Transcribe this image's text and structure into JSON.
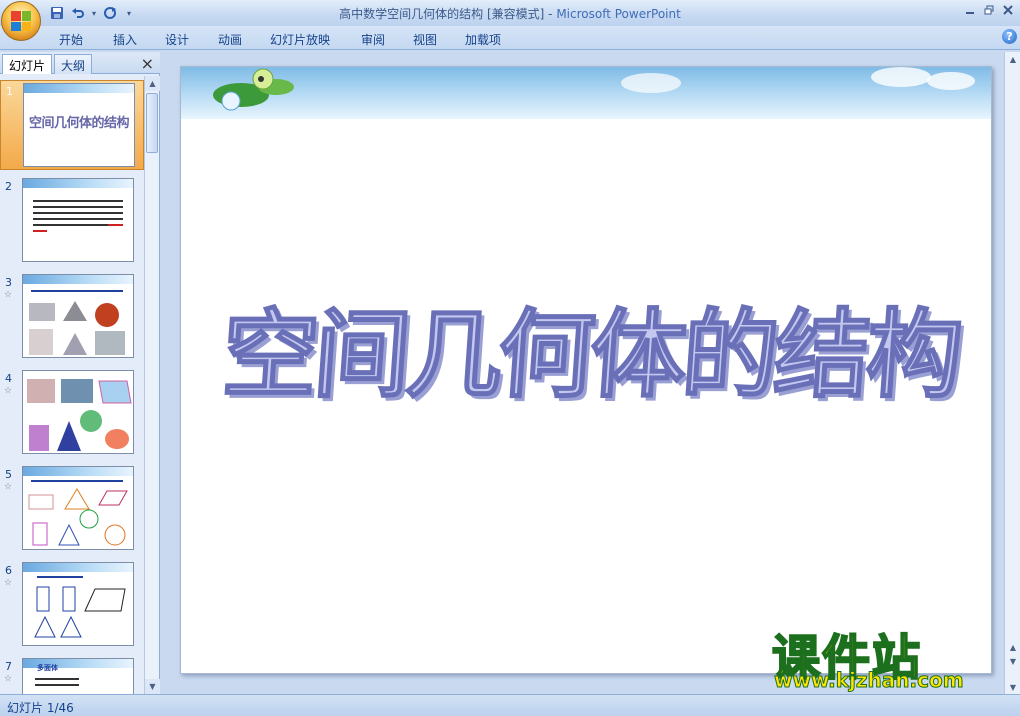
{
  "window": {
    "title": "高中数学空间几何体的结构 [兼容模式]",
    "app_name": "Microsoft PowerPoint",
    "separator": " - "
  },
  "qat": {
    "save": "save-icon",
    "undo": "undo-icon",
    "redo": "redo-icon",
    "customize": "▾"
  },
  "ribbon": {
    "tabs": [
      "开始",
      "插入",
      "设计",
      "动画",
      "幻灯片放映",
      "审阅",
      "视图",
      "加载项"
    ],
    "help": "?"
  },
  "panel": {
    "tab_slides": "幻灯片",
    "tab_outline": "大纲",
    "close": "×",
    "thumbnails": [
      {
        "num": "1",
        "title": "空间几何体的结构",
        "star": ""
      },
      {
        "num": "2",
        "title": "",
        "star": ""
      },
      {
        "num": "3",
        "title": "",
        "star": "☆"
      },
      {
        "num": "4",
        "title": "",
        "star": "☆"
      },
      {
        "num": "5",
        "title": "",
        "star": "☆"
      },
      {
        "num": "6",
        "title": "",
        "star": "☆"
      },
      {
        "num": "7",
        "title": "多面体",
        "star": "☆"
      }
    ]
  },
  "slide": {
    "title": "空间几何体的结构"
  },
  "watermark": {
    "big": "课件站",
    "url": "www.kjzhan.com"
  },
  "status": {
    "slide_counter": "幻灯片 1/46"
  }
}
